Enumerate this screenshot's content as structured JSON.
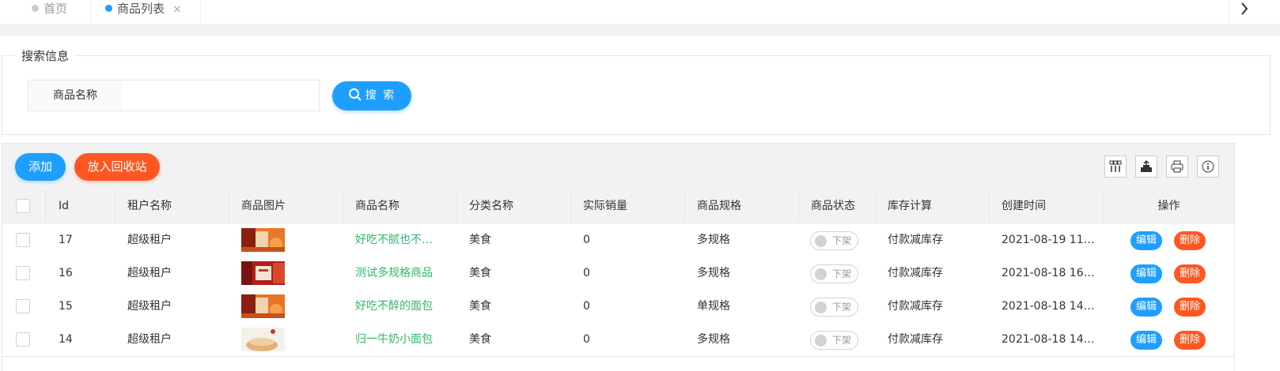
{
  "tabs": [
    {
      "label": "首页",
      "active": false
    },
    {
      "label": "商品列表",
      "active": true,
      "close": "×"
    }
  ],
  "tab_next_icon": "chevron-right-icon",
  "search": {
    "legend": "搜索信息",
    "field_label": "商品名称",
    "value": "",
    "button_label": "搜 索"
  },
  "toolbar": {
    "add_label": "添加",
    "recycle_label": "放入回收站",
    "icons": [
      "columns-icon",
      "export-icon",
      "print-icon",
      "info-icon"
    ]
  },
  "table": {
    "headers": [
      "Id",
      "租户名称",
      "商品图片",
      "商品名称",
      "分类名称",
      "实际销量",
      "商品规格",
      "商品状态",
      "库存计算",
      "创建时间",
      "操作"
    ],
    "rows": [
      {
        "id": "17",
        "tenant": "超级租户",
        "name": "好吃不腻也不…",
        "category": "美食",
        "sales": "0",
        "spec": "多规格",
        "status": "下架",
        "stock": "付款减库存",
        "created": "2021-08-19 11…",
        "edit": "编辑",
        "del": "删除",
        "thumb": "bread"
      },
      {
        "id": "16",
        "tenant": "超级租户",
        "name": "测试多规格商品",
        "category": "美食",
        "sales": "0",
        "spec": "多规格",
        "status": "下架",
        "stock": "付款减库存",
        "created": "2021-08-18 16…",
        "edit": "编辑",
        "del": "删除",
        "thumb": "box"
      },
      {
        "id": "15",
        "tenant": "超级租户",
        "name": "好吃不醉的面包",
        "category": "美食",
        "sales": "0",
        "spec": "单规格",
        "status": "下架",
        "stock": "付款减库存",
        "created": "2021-08-18 14…",
        "edit": "编辑",
        "del": "删除",
        "thumb": "bread"
      },
      {
        "id": "14",
        "tenant": "超级租户",
        "name": "归一牛奶小面包",
        "category": "美食",
        "sales": "0",
        "spec": "多规格",
        "status": "下架",
        "stock": "付款减库存",
        "created": "2021-08-18 14…",
        "edit": "编辑",
        "del": "删除",
        "thumb": "cake"
      }
    ]
  },
  "colors": {
    "primary": "#1e9fff",
    "danger": "#ff5722",
    "link": "#2fb86a"
  }
}
